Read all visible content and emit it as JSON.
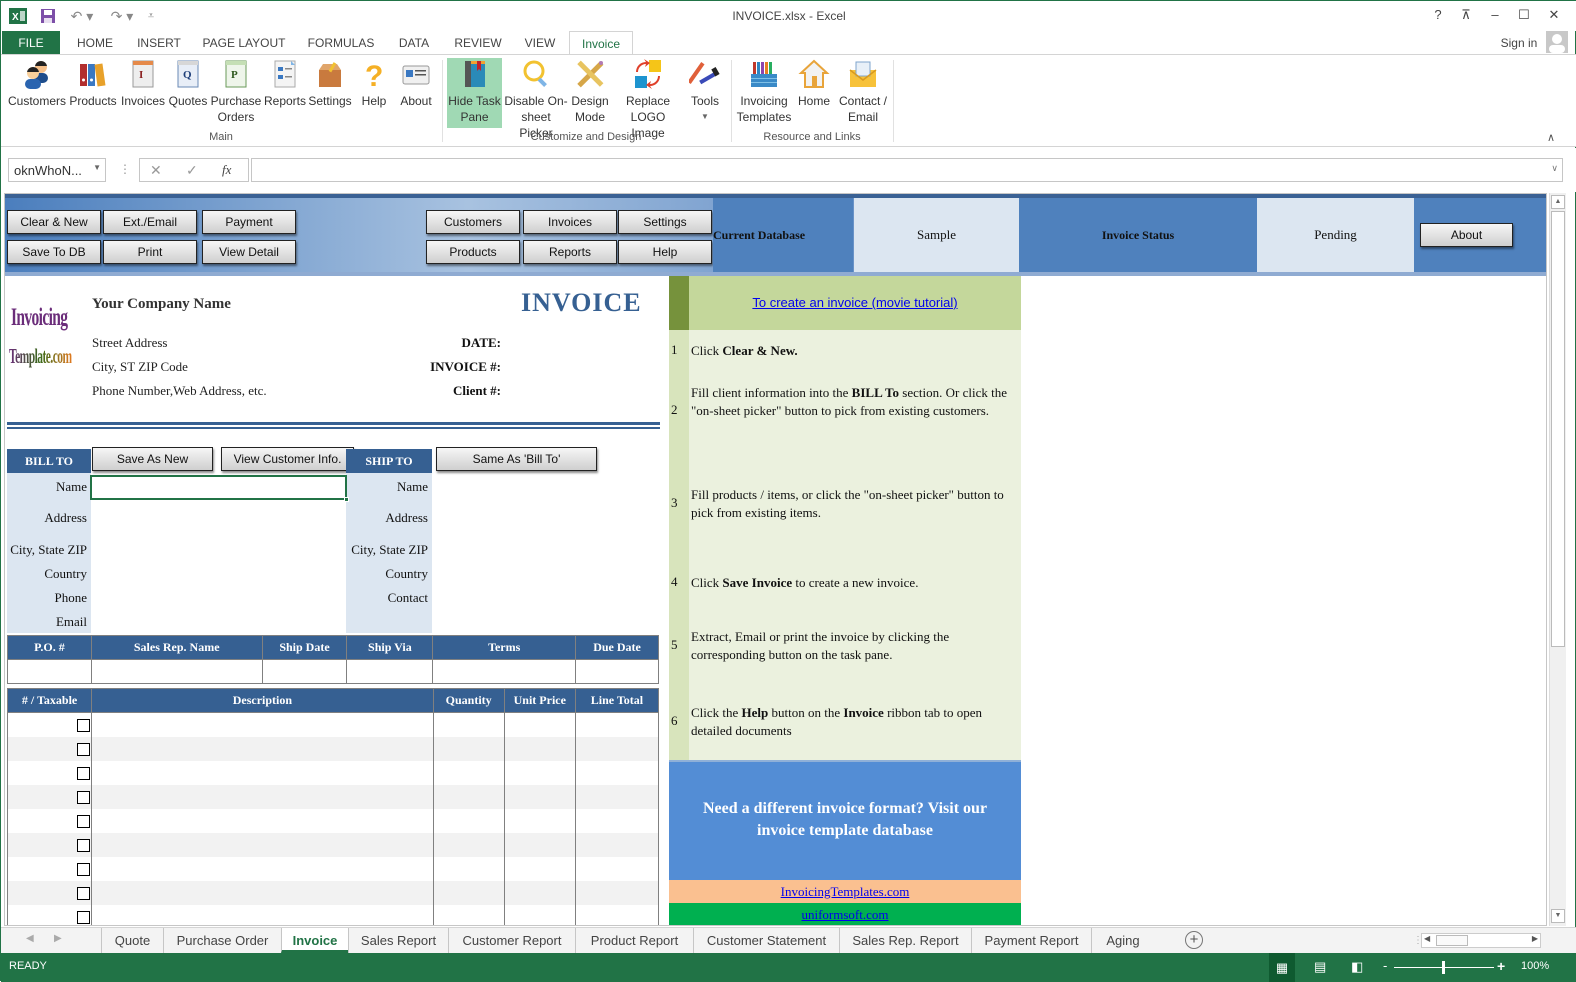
{
  "window": {
    "title": "INVOICE.xlsx - Excel",
    "sign_in": "Sign in"
  },
  "ribbon_tabs": [
    {
      "label": "FILE"
    },
    {
      "label": "HOME"
    },
    {
      "label": "INSERT"
    },
    {
      "label": "PAGE LAYOUT"
    },
    {
      "label": "FORMULAS"
    },
    {
      "label": "DATA"
    },
    {
      "label": "REVIEW"
    },
    {
      "label": "VIEW"
    },
    {
      "label": "Invoice"
    }
  ],
  "ribbon": {
    "groups": [
      {
        "label": "Main",
        "buttons": [
          {
            "label": "Customers",
            "icon": "customers-icon"
          },
          {
            "label": "Products",
            "icon": "binders-icon"
          },
          {
            "label": "Invoices",
            "icon": "invoice-pad-icon"
          },
          {
            "label": "Quotes",
            "icon": "quote-pad-icon"
          },
          {
            "label": "Purchase Orders",
            "icon": "po-pad-icon"
          },
          {
            "label": "Reports",
            "icon": "report-icon"
          },
          {
            "label": "Settings",
            "icon": "toolbox-icon"
          },
          {
            "label": "Help",
            "icon": "question-icon"
          },
          {
            "label": "About",
            "icon": "id-card-icon"
          }
        ]
      },
      {
        "label": "Customize and Design",
        "buttons": [
          {
            "label": "Hide Task Pane",
            "icon": "book-icon",
            "selected": true
          },
          {
            "label": "Disable On-sheet Picker",
            "icon": "magnifier-icon"
          },
          {
            "label": "Design Mode",
            "icon": "pencil-ruler-icon"
          },
          {
            "label": "Replace LOGO Image",
            "icon": "replace-icon"
          },
          {
            "label": "Tools",
            "icon": "wrench-hammer-icon"
          }
        ]
      },
      {
        "label": "Resource and Links",
        "buttons": [
          {
            "label": "Invoicing Templates",
            "icon": "bookshelf-icon"
          },
          {
            "label": "Home",
            "icon": "house-icon"
          },
          {
            "label": "Contact / Email",
            "icon": "envelope-icon"
          }
        ]
      }
    ]
  },
  "formula_bar": {
    "name_box": "oknWhoN...",
    "fx": "fx",
    "value": ""
  },
  "toolbar": {
    "left": [
      "Clear & New",
      "Ext./Email",
      "Payment",
      "Save To DB",
      "Print",
      "View Detail"
    ],
    "right": [
      "Customers",
      "Invoices",
      "Settings",
      "Products",
      "Reports",
      "Help"
    ],
    "current_database_label": "Current Database",
    "current_database_value": "Sample",
    "invoice_status_label": "Invoice Status",
    "invoice_status_value": "Pending",
    "about": "About"
  },
  "invoice": {
    "logo_line1": "Invoicing",
    "logo_line2": "Template.com",
    "company_name": "Your Company Name",
    "title": "INVOICE",
    "address_lines": [
      "Street Address",
      "City, ST  ZIP Code",
      "Phone Number,Web Address, etc."
    ],
    "meta_labels": [
      "DATE:",
      "INVOICE #:",
      "Client #:"
    ],
    "bill_to": "BILL TO",
    "ship_to": "SHIP TO",
    "save_as_new": "Save As New",
    "view_customer_info": "View Customer Info.",
    "same_as_bill_to": "Same As 'Bill To'",
    "bill_fields": [
      "Name",
      "Address",
      "City, State ZIP",
      "Country",
      "Phone",
      "Email"
    ],
    "ship_fields": [
      "Name",
      "Address",
      "City, State ZIP",
      "Country",
      "Contact"
    ],
    "order_headers": [
      "P.O. #",
      "Sales Rep. Name",
      "Ship Date",
      "Ship Via",
      "Terms",
      "Due Date"
    ],
    "item_headers": [
      "# / Taxable",
      "Description",
      "Quantity",
      "Unit Price",
      "Line Total"
    ],
    "item_row_count": 9
  },
  "task_pane": {
    "tutorial_link": "To create an invoice (movie tutorial)",
    "steps": [
      {
        "num": "1",
        "html": "Click <b>Clear &amp; New.</b>"
      },
      {
        "num": "2",
        "html": "Fill client information into the <b>BILL To</b> section. Or click the \"on-sheet picker\" button to pick from existing customers."
      },
      {
        "num": "3",
        "html": "Fill products / items, or click the \"on-sheet picker\" button to pick from existing items."
      },
      {
        "num": "4",
        "html": "Click <b>Save Invoice</b> to create a new invoice."
      },
      {
        "num": "5",
        "html": "Extract, Email or print the invoice by clicking the corresponding button on the task pane."
      },
      {
        "num": "6",
        "html": "Click the <b>Help</b> button on the <b>Invoice</b> ribbon tab to open detailed documents"
      }
    ],
    "promo": "Need a different invoice format? Visit our invoice template database",
    "link1": "InvoicingTemplates.com ",
    "link2": "uniformsoft.com "
  },
  "sheet_tabs": [
    "Quote",
    "Purchase Order",
    "Invoice",
    "Sales Report",
    "Customer Report",
    "Product Report",
    "Customer Statement",
    "Sales Rep. Report",
    "Payment Report",
    "Aging"
  ],
  "active_sheet": "Invoice",
  "status": {
    "text": "READY",
    "zoom": "100%"
  },
  "colors": {
    "excel_green": "#217346",
    "header_blue": "#366092",
    "pane_blue": "#4f81bd",
    "light_blue": "#dce6f1",
    "tp_green": "#c4d79b",
    "tp_light": "#ebf1de",
    "promo_blue": "#538dd5",
    "peach": "#fac090",
    "green_band": "#00b050"
  }
}
